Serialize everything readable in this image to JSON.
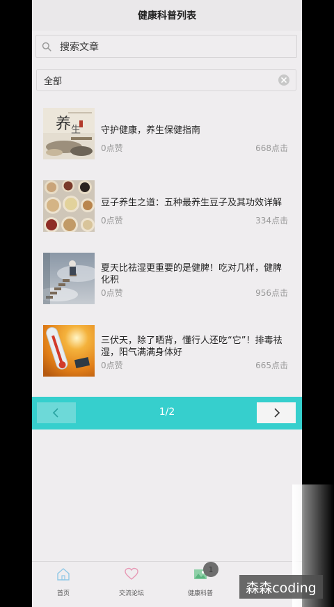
{
  "header": {
    "title": "健康科普列表"
  },
  "search": {
    "placeholder": "搜索文章"
  },
  "filter": {
    "value": "全部"
  },
  "articles": [
    {
      "title": "守护健康，养生保健指南",
      "likes": "0点赞",
      "clicks": "668点击",
      "thumb": "yangsheng-scroll"
    },
    {
      "title": "豆子养生之道：五种最养生豆子及其功效详解",
      "likes": "0点赞",
      "clicks": "334点击",
      "thumb": "bowls-of-beans"
    },
    {
      "title": "夏天比祛湿更重要的是健脾！吃对几样，健脾化积",
      "likes": "0点赞",
      "clicks": "956点击",
      "thumb": "elderly-stairs"
    },
    {
      "title": "三伏天，除了晒背，懂行人还吃“它”！排毒祛湿，阳气满满身体好",
      "likes": "0点赞",
      "clicks": "665点击",
      "thumb": "thermometer-sun"
    }
  ],
  "pager": {
    "page": "1/2"
  },
  "tabbar": {
    "items": [
      {
        "label": "首页",
        "icon": "home-icon"
      },
      {
        "label": "交流论坛",
        "icon": "heart-icon"
      },
      {
        "label": "健康科普",
        "icon": "image-icon"
      }
    ],
    "badge": "1"
  },
  "colors": {
    "accent": "#36cfcd",
    "background": "#efedef"
  },
  "watermark": {
    "text": "森森coding"
  }
}
